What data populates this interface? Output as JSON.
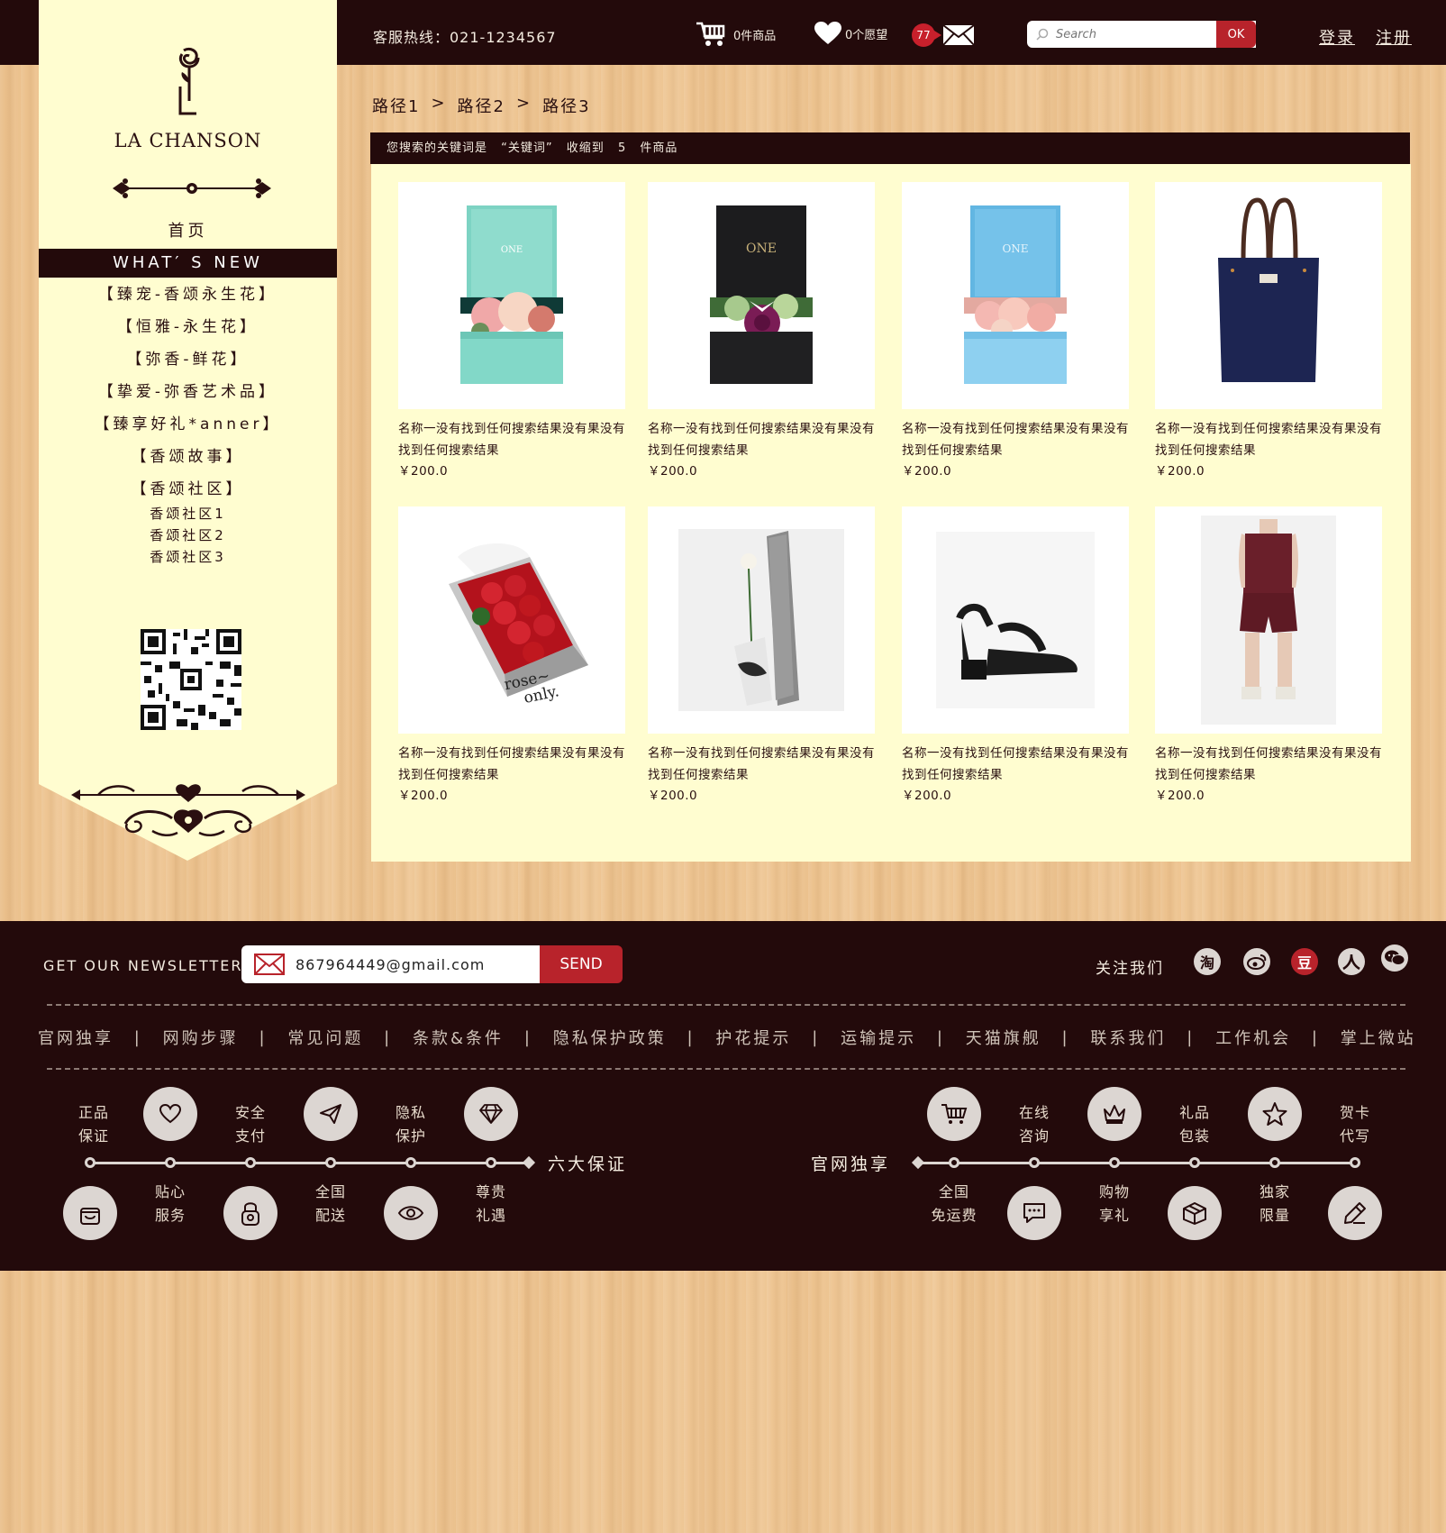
{
  "header": {
    "hotline": "客服热线：021-1234567",
    "cart_label": "0件商品",
    "wish_label": "0个愿望",
    "message_count": "77",
    "search_placeholder": "Search",
    "search_button": "OK",
    "login": "登录",
    "register": "注册"
  },
  "sidebar": {
    "logo_text": "LA CHANSON",
    "home": "首页",
    "whats_new": "WHAT′ S NEW",
    "categories": [
      "【臻宠-香颂永生花】",
      "【恒雅-永生花】",
      "【弥香-鲜花】",
      "【挚爱-弥香艺术品】",
      "【臻享好礼*anner】",
      "【香颂故事】",
      "【香颂社区】"
    ],
    "sub_items": [
      "香颂社区1",
      "香颂社区2",
      "香颂社区3"
    ]
  },
  "breadcrumb": [
    "路径1",
    ">",
    "路径2",
    ">",
    "路径3"
  ],
  "search_result": {
    "prefix": "您搜索的关键词是",
    "keyword": "“关键词”",
    "middle": "收缩到",
    "count": "5",
    "suffix": "件商品"
  },
  "products": [
    {
      "name": "名称一没有找到任何搜索结果没有果没有找到任何搜索结果",
      "price": "￥200.0",
      "image": "teal-flower-box"
    },
    {
      "name": "名称一没有找到任何搜索结果没有果没有找到任何搜索结果",
      "price": "￥200.0",
      "image": "black-flower-box"
    },
    {
      "name": "名称一没有找到任何搜索结果没有果没有找到任何搜索结果",
      "price": "￥200.0",
      "image": "blue-flower-box"
    },
    {
      "name": "名称一没有找到任何搜索结果没有果没有找到任何搜索结果",
      "price": "￥200.0",
      "image": "navy-tote-bag"
    },
    {
      "name": "名称一没有找到任何搜索结果没有果没有找到任何搜索结果",
      "price": "￥200.0",
      "image": "red-rose-box"
    },
    {
      "name": "名称一没有找到任何搜索结果没有果没有找到任何搜索结果",
      "price": "￥200.0",
      "image": "single-rose-box"
    },
    {
      "name": "名称一没有找到任何搜索结果没有果没有找到任何搜索结果",
      "price": "￥200.0",
      "image": "black-sandal"
    },
    {
      "name": "名称一没有找到任何搜索结果没有果没有找到任何搜索结果",
      "price": "￥200.0",
      "image": "burgundy-romper"
    }
  ],
  "footer": {
    "newsletter_label": "GET OUR NEWSLETTER",
    "newsletter_email": "867964449@gmail.com",
    "newsletter_send": "SEND",
    "follow_us": "关注我们",
    "social_icons": [
      "taobao-icon",
      "weibo-icon",
      "douban-icon",
      "renren-icon",
      "wechat-icon"
    ],
    "links": [
      "官网独享",
      "网购步骤",
      "常见问题",
      "条款&条件",
      "隐私保护政策",
      "护花提示",
      "运输提示",
      "天猫旗舰",
      "联系我们",
      "工作机会",
      "掌上微站"
    ],
    "separator": "|",
    "guarantees_title": "六大保证",
    "guarantees": [
      {
        "label_line1": "正品",
        "label_line2": "保证",
        "icon": "bag-icon"
      },
      {
        "label_line1": "贴心",
        "label_line2": "服务",
        "icon": "heart-icon"
      },
      {
        "label_line1": "安全",
        "label_line2": "支付",
        "icon": "lock-icon"
      },
      {
        "label_line1": "全国",
        "label_line2": "配送",
        "icon": "paper-plane-icon"
      },
      {
        "label_line1": "隐私",
        "label_line2": "保护",
        "icon": "eye-icon"
      },
      {
        "label_line1": "尊贵",
        "label_line2": "礼遇",
        "icon": "diamond-icon"
      }
    ],
    "exclusive_title": "官网独享",
    "exclusives": [
      {
        "label_line1": "全国",
        "label_line2": "免运费",
        "icon": "cart-icon"
      },
      {
        "label_line1": "在线",
        "label_line2": "咨询",
        "icon": "chat-icon"
      },
      {
        "label_line1": "购物",
        "label_line2": "享礼",
        "icon": "crown-icon"
      },
      {
        "label_line1": "礼品",
        "label_line2": "包装",
        "icon": "gift-box-icon"
      },
      {
        "label_line1": "独家",
        "label_line2": "限量",
        "icon": "star-icon"
      },
      {
        "label_line1": "贺卡",
        "label_line2": "代写",
        "icon": "pen-icon"
      }
    ]
  },
  "colors": {
    "dark_maroon": "#230a0b",
    "cream": "#fffdd0",
    "accent_red": "#b8232b",
    "wood": "#edc38f"
  }
}
